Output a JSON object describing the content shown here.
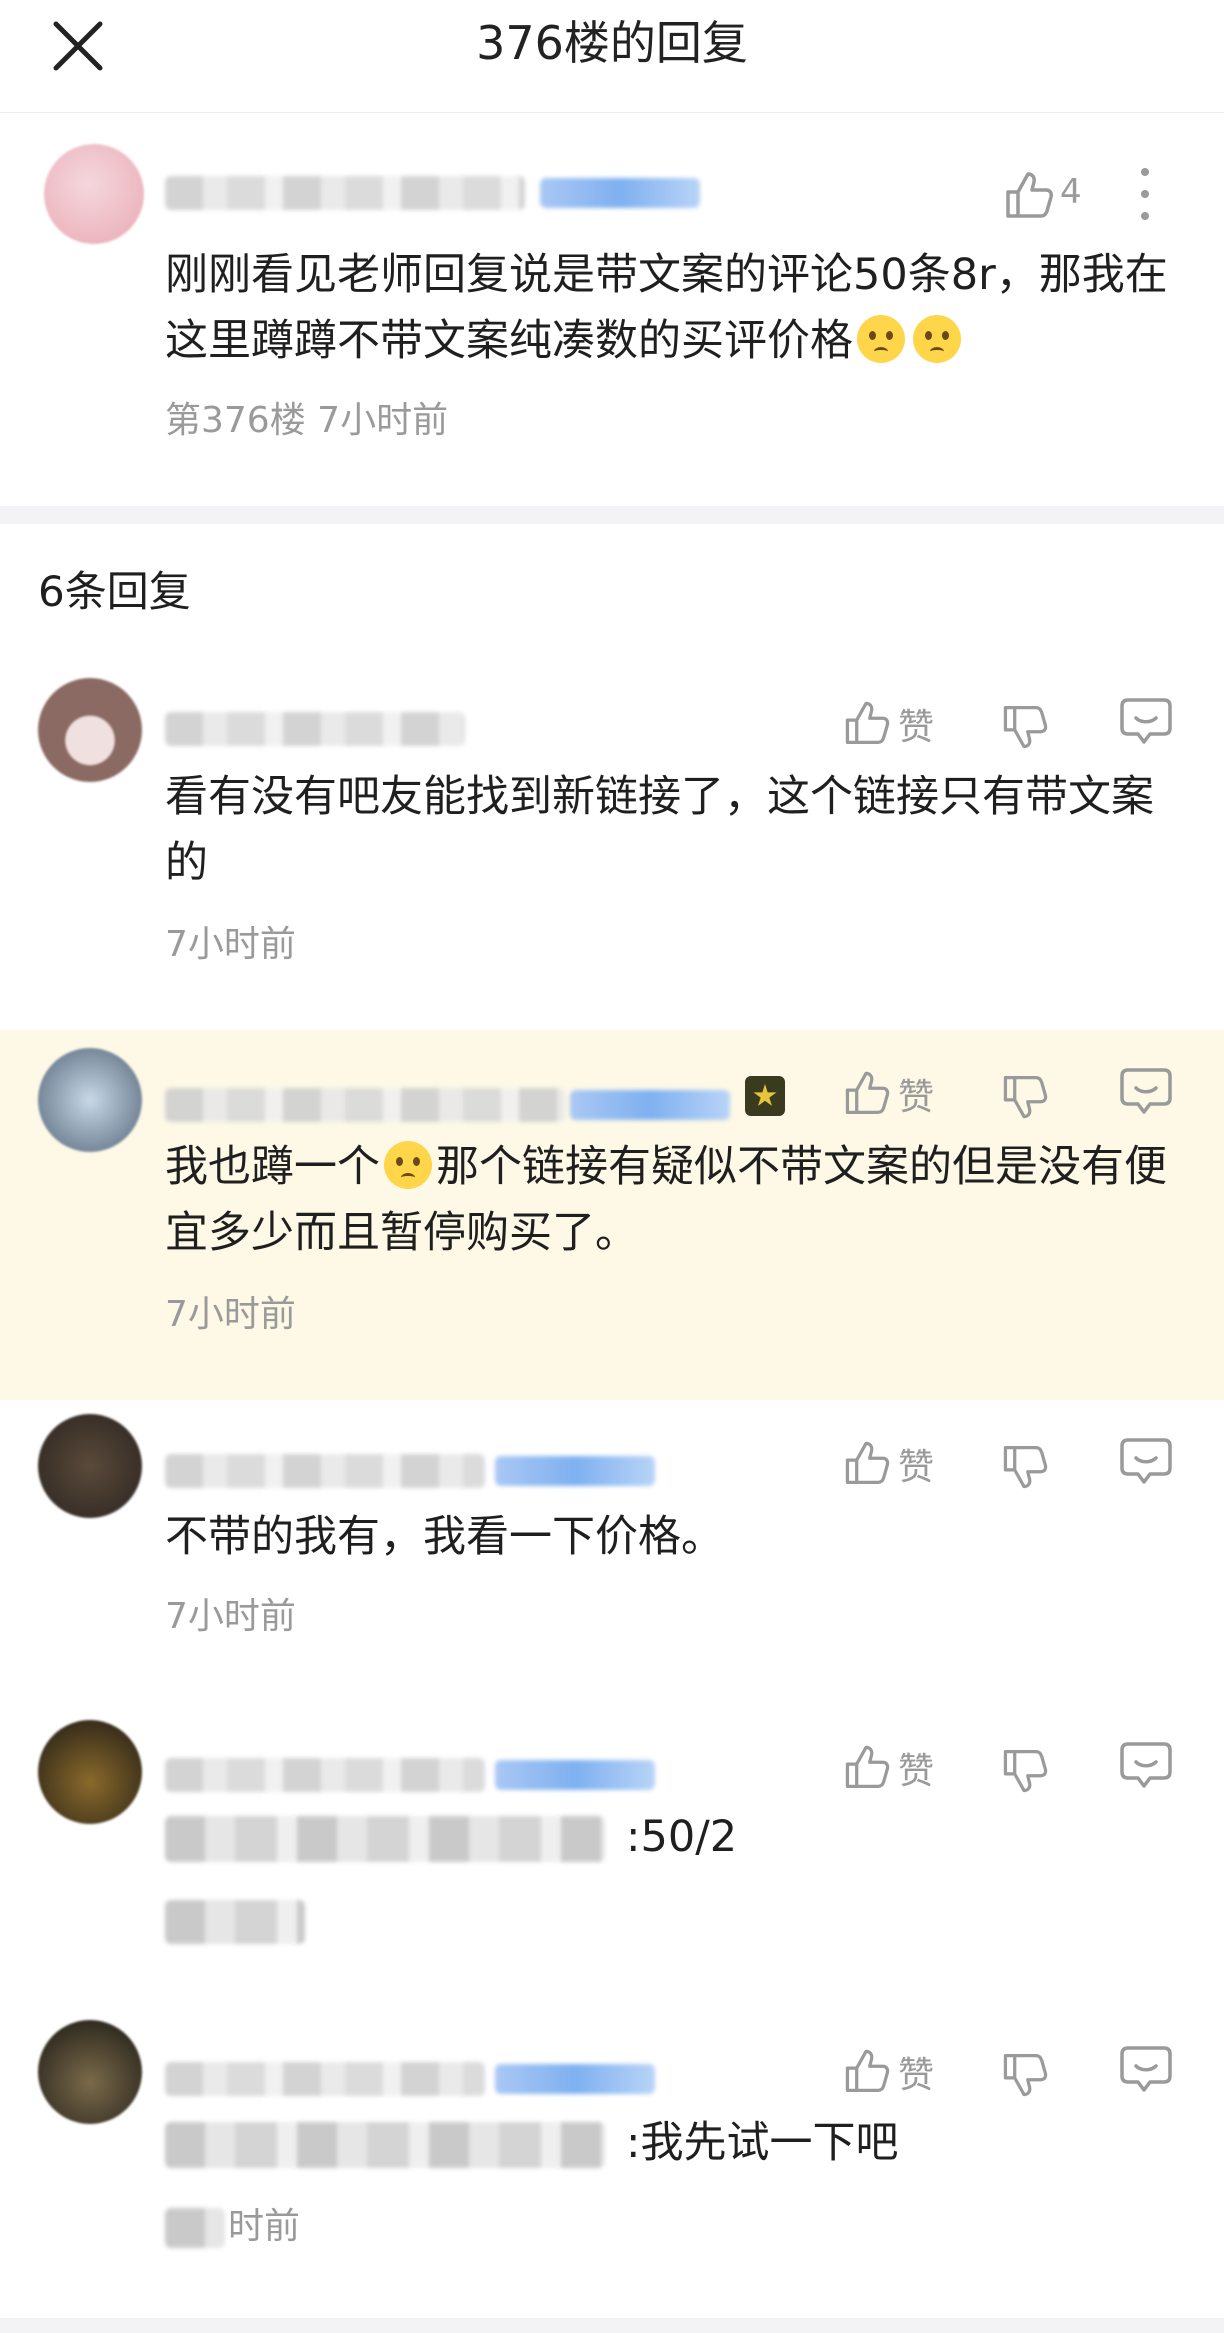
{
  "header": {
    "title": "376楼的回复",
    "close_icon": "close-icon"
  },
  "main_comment": {
    "text_part1": "刚刚看见老师回复说是带文案的评论50条8r，那我在这里蹲蹲不带文案纯凑数的买评价格",
    "like_count": "4",
    "floor": "第376楼",
    "time": "7小时前"
  },
  "replies_header": "6条回复",
  "actions": {
    "like_label": "赞"
  },
  "replies": [
    {
      "text": "看有没有吧友能找到新链接了，这个链接只有带文案的",
      "time": "7小时前"
    },
    {
      "text_before": "我也蹲一个",
      "text_after": "那个链接有疑似不带文案的但是没有便宜多少而且暂停购买了。",
      "time": "7小时前"
    },
    {
      "text": "不带的我有，我看一下价格。",
      "time": "7小时前"
    },
    {
      "text": ":50/2",
      "time": ""
    },
    {
      "text": ":我先试一下吧",
      "time_visible": "时前"
    }
  ],
  "colors": {
    "highlight_bg": "#fdf9e6",
    "muted_text": "#9a9a9a",
    "badge_blue": "#7fb0f0"
  }
}
